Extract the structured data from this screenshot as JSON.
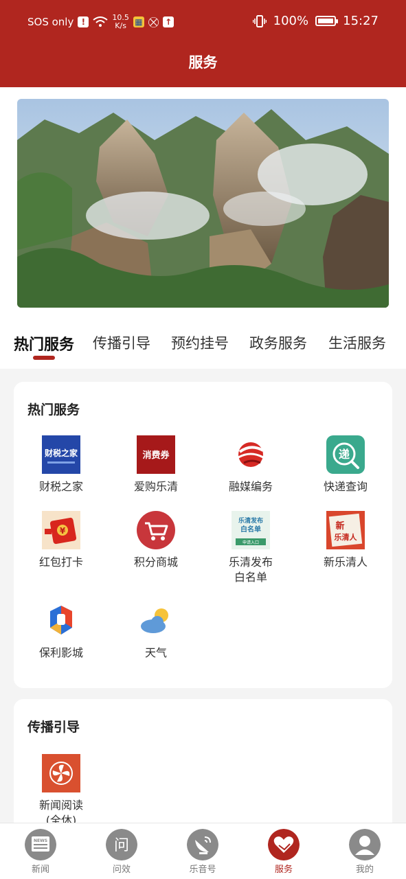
{
  "status_bar": {
    "carrier": "SOS only",
    "net_speed": "10.5",
    "net_speed_unit": "K/s",
    "battery": "100%",
    "time": "15:27"
  },
  "header": {
    "title": "服务"
  },
  "tabs": [
    {
      "label": "热门服务",
      "active": true
    },
    {
      "label": "传播引导",
      "active": false
    },
    {
      "label": "预约挂号",
      "active": false
    },
    {
      "label": "政务服务",
      "active": false
    },
    {
      "label": "生活服务",
      "active": false
    }
  ],
  "sections": [
    {
      "title": "热门服务",
      "items": [
        {
          "label": "财税之家",
          "icon": "caishui-icon",
          "icon_text": "财税之家"
        },
        {
          "label": "爱购乐清",
          "icon": "coupon-icon",
          "icon_text": "消费券"
        },
        {
          "label": "融媒编务",
          "icon": "rongmei-logo-icon"
        },
        {
          "label": "快递查询",
          "icon": "express-icon",
          "icon_text": "递"
        },
        {
          "label": "红包打卡",
          "icon": "red-packet-icon",
          "icon_text": "¥"
        },
        {
          "label": "积分商城",
          "icon": "shopping-cart-icon"
        },
        {
          "label": "乐清发布\n白名单",
          "icon": "whitelist-icon",
          "icon_text": "乐清发布",
          "icon_text2": "白名单",
          "icon_text3": "申请入口"
        },
        {
          "label": "新乐清人",
          "icon": "xinleqing-icon",
          "icon_text": "新",
          "icon_text2": "乐清人"
        },
        {
          "label": "保利影城",
          "icon": "poly-cinema-icon"
        },
        {
          "label": "天气",
          "icon": "weather-icon"
        }
      ]
    },
    {
      "title": "传播引导",
      "items": [
        {
          "label": "新闻阅读\n(全休)",
          "icon": "news-reading-icon"
        }
      ]
    }
  ],
  "bottom_nav": [
    {
      "label": "新闻",
      "icon": "news-icon",
      "active": false,
      "icon_text": "NEWS"
    },
    {
      "label": "问效",
      "icon": "ask-icon",
      "active": false,
      "icon_text": "问"
    },
    {
      "label": "乐音号",
      "icon": "satellite-icon",
      "active": false
    },
    {
      "label": "服务",
      "icon": "heart-hand-icon",
      "active": true
    },
    {
      "label": "我的",
      "icon": "person-icon",
      "active": false
    }
  ],
  "colors": {
    "brand_red": "#b0261f",
    "background": "#f4f4f4"
  }
}
